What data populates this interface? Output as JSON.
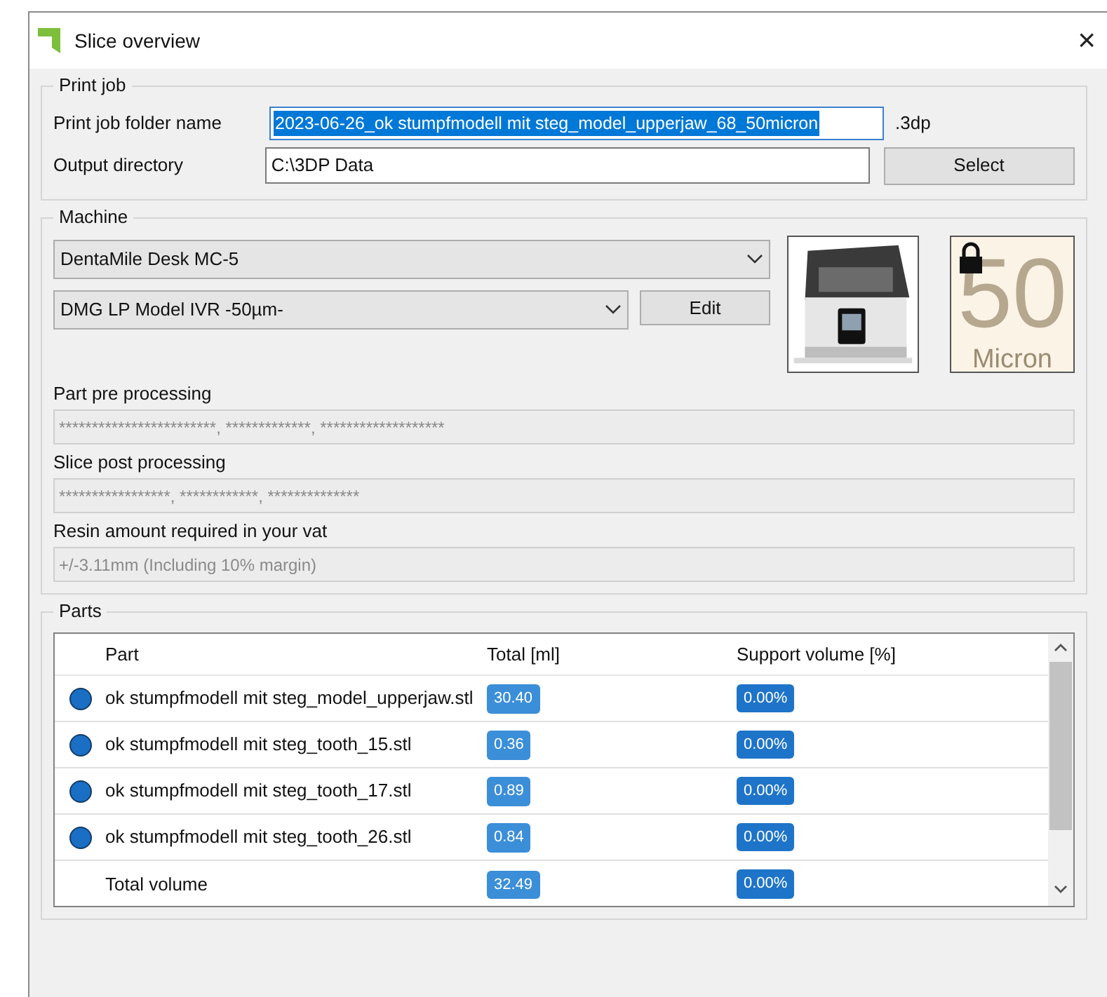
{
  "window": {
    "title": "Slice overview",
    "close": "×"
  },
  "print_job": {
    "title": "Print job",
    "folder_label": "Print job folder name",
    "folder_value": "2023-06-26_ok stumpfmodell mit steg_model_upperjaw_68_50micron",
    "folder_selected": true,
    "extension": ".3dp",
    "output_label": "Output directory",
    "output_value": "C:\\3DP Data",
    "select_button": "Select"
  },
  "machine": {
    "title": "Machine",
    "printer": "DentaMile Desk MC-5",
    "material": "DMG LP Model IVR -50µm-",
    "edit_button": "Edit",
    "layer_badge": {
      "value": "50",
      "unit": "Micron",
      "locked": true
    },
    "pre_label": "Part pre processing",
    "pre_value": "************************, *************, *******************",
    "post_label": "Slice post processing",
    "post_value": "*****************, ************, **************",
    "resin_label": "Resin amount required in your vat",
    "resin_value": "+/-3.11mm (Including 10% margin)"
  },
  "parts": {
    "title": "Parts",
    "columns": [
      "Part",
      "Total [ml]",
      "Support volume [%]"
    ],
    "rows": [
      {
        "kind": "part",
        "name": "ok stumpfmodell mit steg_model_upperjaw.stl",
        "total": "30.40",
        "support": "0.00%"
      },
      {
        "kind": "part",
        "name": "ok stumpfmodell mit steg_tooth_15.stl",
        "total": "0.36",
        "support": "0.00%"
      },
      {
        "kind": "part",
        "name": "ok stumpfmodell mit steg_tooth_17.stl",
        "total": "0.89",
        "support": "0.00%"
      },
      {
        "kind": "part",
        "name": "ok stumpfmodell mit steg_tooth_26.stl",
        "total": "0.84",
        "support": "0.00%"
      },
      {
        "kind": "total",
        "name": "Total volume",
        "total": "32.49",
        "support": "0.00%"
      }
    ]
  }
}
